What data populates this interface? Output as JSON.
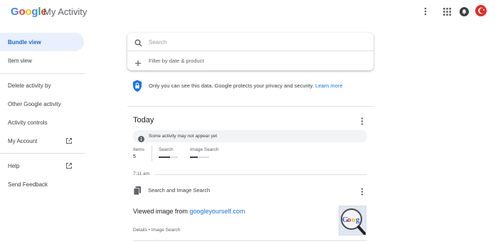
{
  "header": {
    "logo_letters": [
      {
        "ch": "G",
        "color": "#4285F4"
      },
      {
        "ch": "o",
        "color": "#EA4335"
      },
      {
        "ch": "o",
        "color": "#FBBC05"
      },
      {
        "ch": "g",
        "color": "#4285F4"
      },
      {
        "ch": "l",
        "color": "#34A853"
      },
      {
        "ch": "e",
        "color": "#EA4335"
      }
    ],
    "product": "My Activity",
    "icons": [
      "more-vert-icon",
      "apps-icon",
      "notifications-icon",
      "account-avatar"
    ]
  },
  "sidebar": {
    "items": [
      {
        "label": "Bundle view",
        "active": true
      },
      {
        "label": "Item view"
      },
      {
        "label": "Delete activity by"
      },
      {
        "label": "Other Google activity"
      },
      {
        "label": "Activity controls"
      },
      {
        "label": "My Account",
        "external": true
      },
      {
        "label": "Help",
        "external": true
      },
      {
        "label": "Send Feedback"
      }
    ]
  },
  "search": {
    "placeholder": "Search",
    "filter_label": "Filter by date & product"
  },
  "privacy": {
    "text": "Only you can see this data. Google protects your privacy and security.",
    "link": "Learn more"
  },
  "today": {
    "title": "Today",
    "notice": "Some activity may not appear yet",
    "items_label": "Items",
    "items_value": "5",
    "products": [
      {
        "name": "Search",
        "fill": 0.6
      },
      {
        "name": "Image Search",
        "fill": 0.4
      }
    ],
    "time": "7:11 am",
    "group_title": "Search and Image Search",
    "viewed_prefix": "Viewed image from",
    "viewed_link": "googleyourself.com",
    "details": "Details • Image Search"
  },
  "colors": {
    "accent": "#1a73e8",
    "active_bg": "#e8f0fe",
    "privacy_shield": "#1a73e8"
  }
}
